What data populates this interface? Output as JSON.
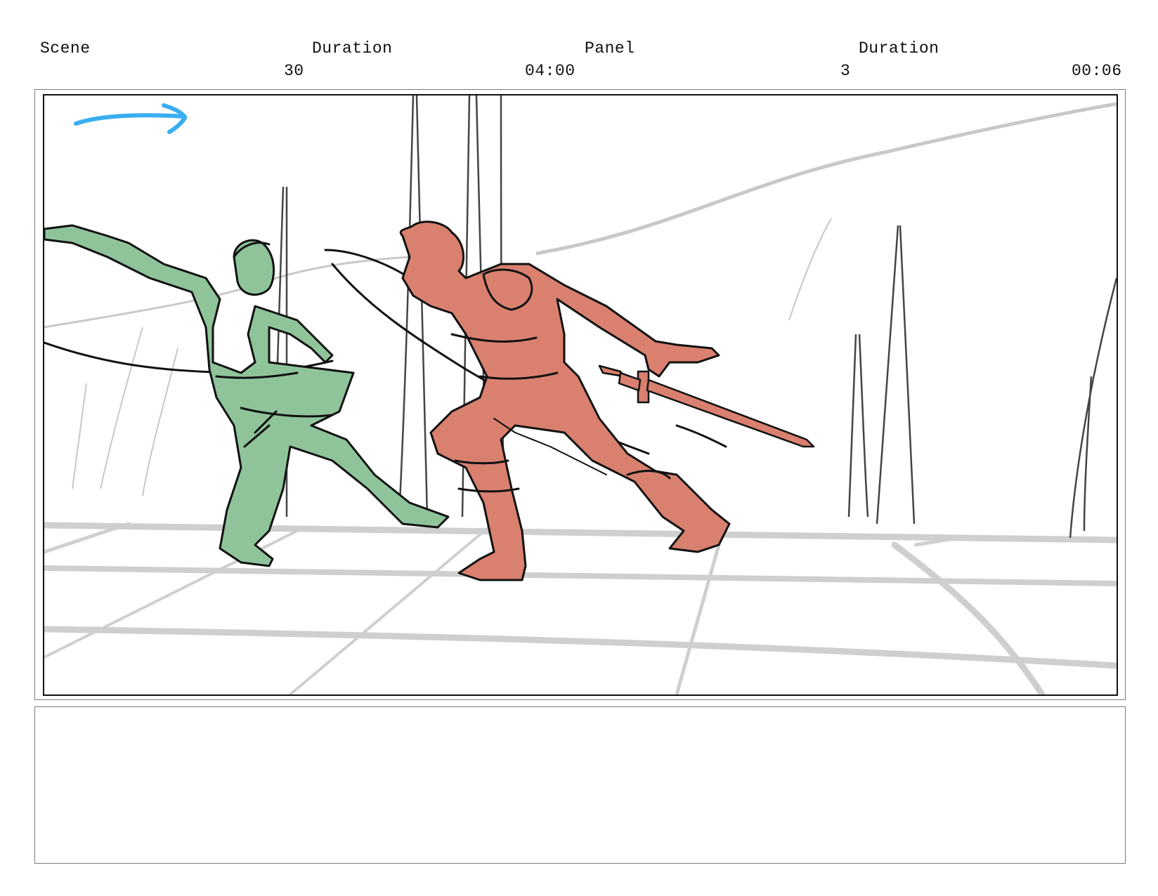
{
  "header": {
    "scene_label": "Scene",
    "scene_value": "30",
    "scene_duration_label": "Duration",
    "scene_duration_value": "04:00",
    "panel_label": "Panel",
    "panel_value": "3",
    "panel_duration_label": "Duration",
    "panel_duration_value": "00:06"
  },
  "panel": {
    "camera_move_icon": "right-arrow-icon",
    "colors": {
      "arrow": "#3aaef0",
      "character_left": "#8fc49b",
      "character_right": "#d9806f",
      "line": "#111111",
      "background_line": "#c8c8c8"
    }
  },
  "notes": {
    "text": ""
  }
}
